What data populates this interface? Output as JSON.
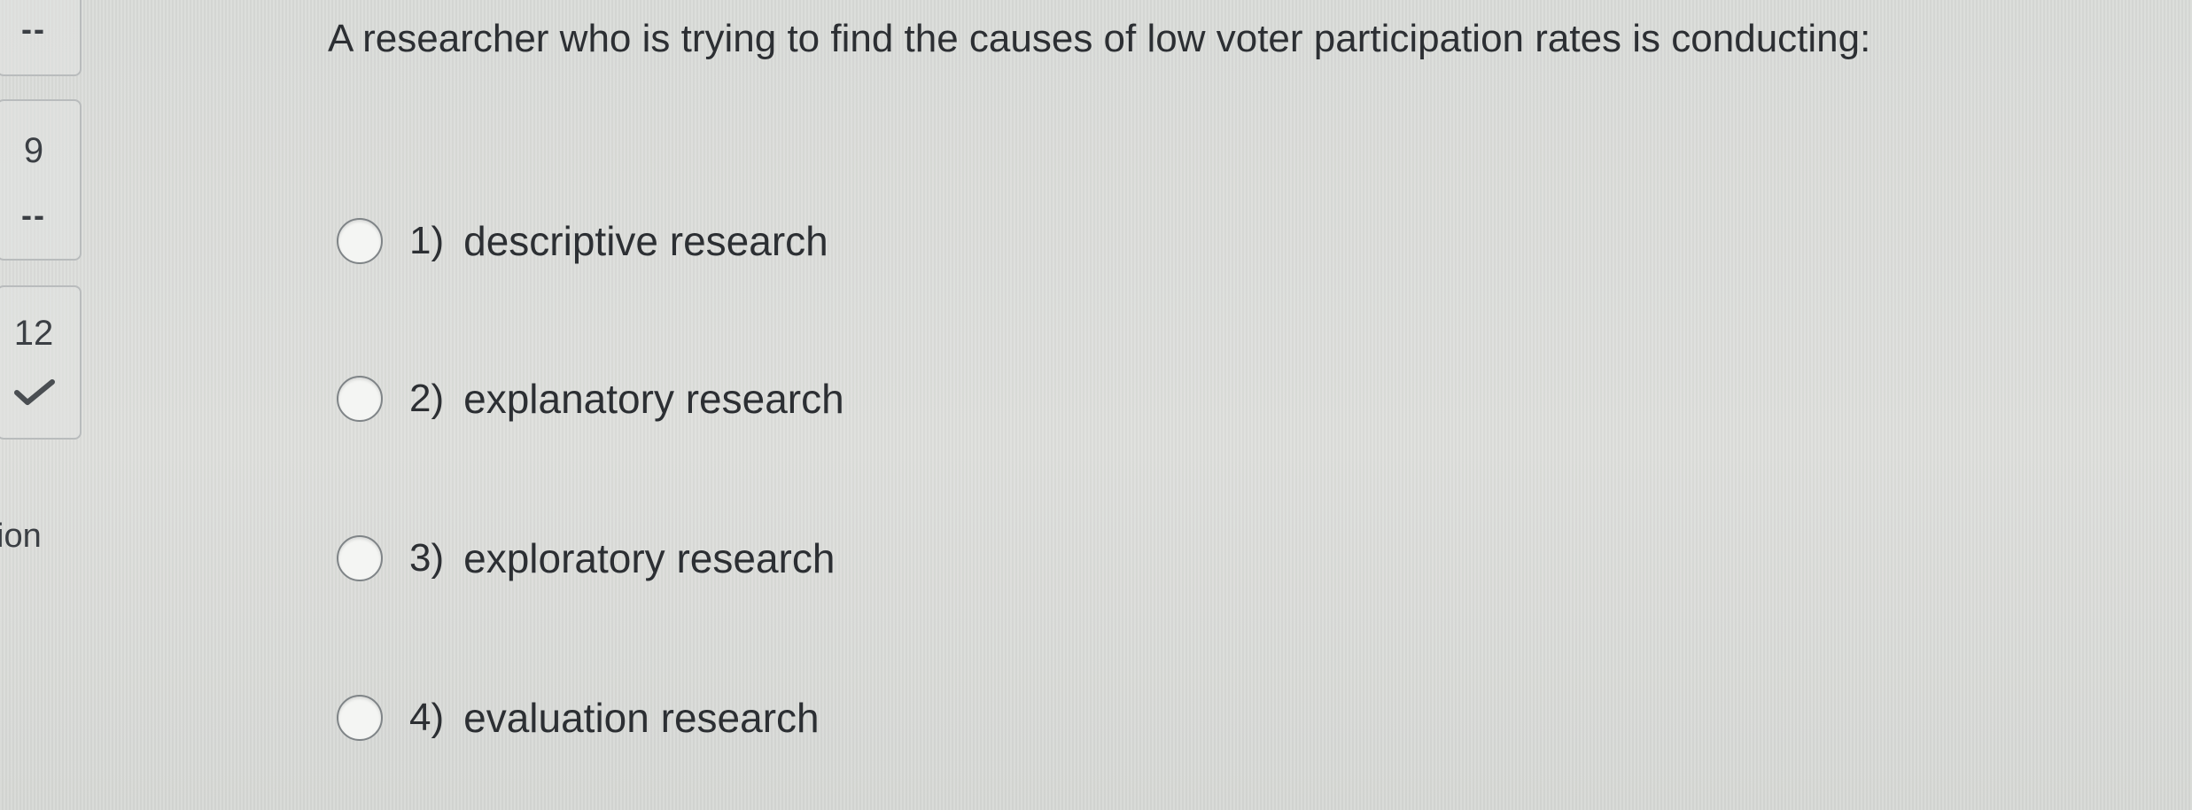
{
  "navigator": {
    "top_card": {
      "status": "--"
    },
    "question_9": {
      "number": "9",
      "status": "--"
    },
    "question_12": {
      "number": "12",
      "status_icon": "checkmark-icon"
    },
    "partial_label": "ion"
  },
  "question": {
    "text": "A researcher who is trying to find the causes of low voter participation rates is conducting:"
  },
  "options": [
    {
      "number": "1)",
      "label": "descriptive research"
    },
    {
      "number": "2)",
      "label": "explanatory research"
    },
    {
      "number": "3)",
      "label": "exploratory research"
    },
    {
      "number": "4)",
      "label": "evaluation research"
    }
  ],
  "colors": {
    "background": "#dcdedb",
    "text": "#2c2f33",
    "check": "#4a4e52"
  }
}
